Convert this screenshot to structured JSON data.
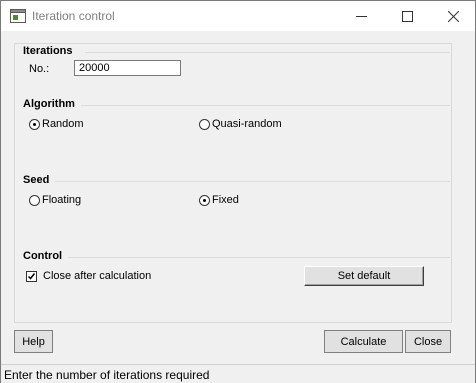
{
  "window": {
    "title": "Iteration control"
  },
  "iterations": {
    "title": "Iterations",
    "no_label": "No.:",
    "no_value": "20000"
  },
  "algorithm": {
    "title": "Algorithm",
    "options": [
      "Random",
      "Quasi-random"
    ],
    "selected": "Random"
  },
  "seed": {
    "title": "Seed",
    "options": [
      "Floating",
      "Fixed"
    ],
    "selected": "Fixed"
  },
  "control": {
    "title": "Control",
    "close_after_label": "Close after calculation",
    "close_after_checked": true,
    "set_default_label": "Set default"
  },
  "buttons": {
    "help": "Help",
    "calculate": "Calculate",
    "close": "Close"
  },
  "status": {
    "text": "Enter the number of iterations required"
  }
}
